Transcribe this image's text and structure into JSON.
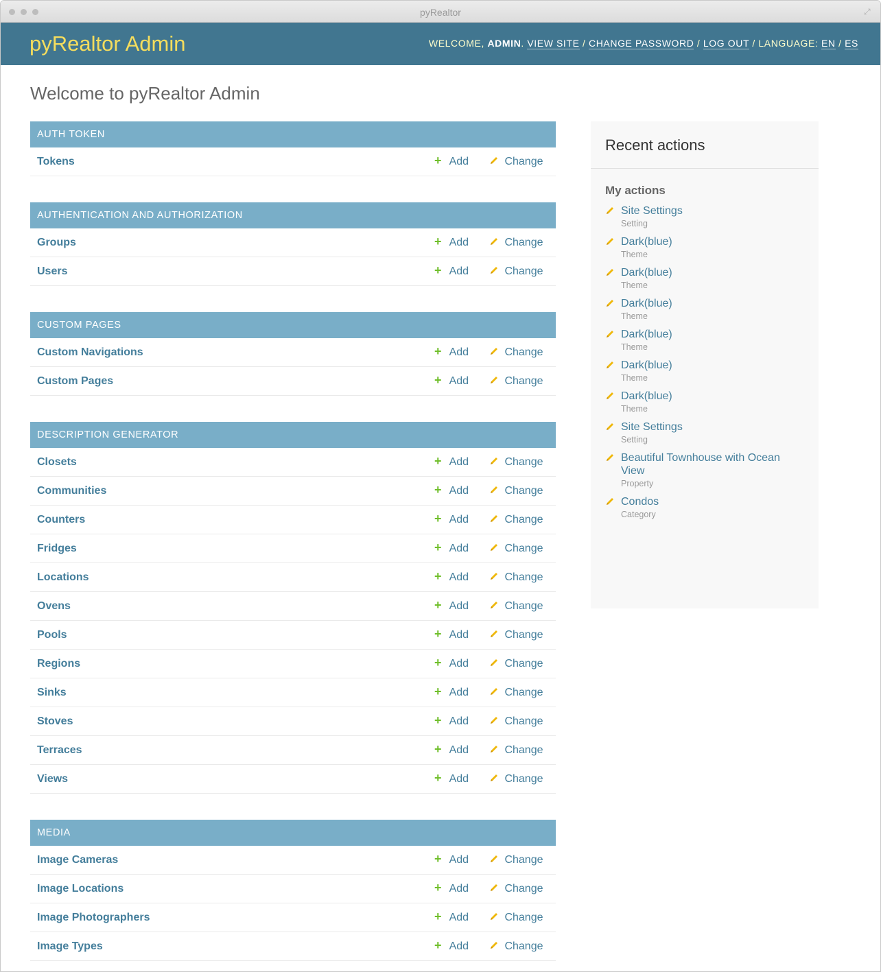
{
  "window": {
    "title": "pyRealtor"
  },
  "header": {
    "brand": "pyRealtor Admin",
    "welcome": "WELCOME,",
    "username": "ADMIN",
    "links": {
      "view_site": "VIEW SITE",
      "change_password": "CHANGE PASSWORD",
      "log_out": "LOG OUT",
      "language_label": "LANGUAGE:",
      "lang_en": "EN",
      "lang_es": "ES"
    }
  },
  "page": {
    "title": "Welcome to pyRealtor Admin"
  },
  "labels": {
    "add": "Add",
    "change": "Change"
  },
  "modules": [
    {
      "caption": "AUTH TOKEN",
      "models": [
        "Tokens"
      ]
    },
    {
      "caption": "AUTHENTICATION AND AUTHORIZATION",
      "models": [
        "Groups",
        "Users"
      ]
    },
    {
      "caption": "CUSTOM PAGES",
      "models": [
        "Custom Navigations",
        "Custom Pages"
      ]
    },
    {
      "caption": "DESCRIPTION GENERATOR",
      "models": [
        "Closets",
        "Communities",
        "Counters",
        "Fridges",
        "Locations",
        "Ovens",
        "Pools",
        "Regions",
        "Sinks",
        "Stoves",
        "Terraces",
        "Views"
      ]
    },
    {
      "caption": "MEDIA",
      "models": [
        "Image Cameras",
        "Image Locations",
        "Image Photographers",
        "Image Types"
      ]
    }
  ],
  "sidebar": {
    "title": "Recent actions",
    "subtitle": "My actions",
    "actions": [
      {
        "name": "Site Settings",
        "type": "Setting"
      },
      {
        "name": "Dark(blue)",
        "type": "Theme"
      },
      {
        "name": "Dark(blue)",
        "type": "Theme"
      },
      {
        "name": "Dark(blue)",
        "type": "Theme"
      },
      {
        "name": "Dark(blue)",
        "type": "Theme"
      },
      {
        "name": "Dark(blue)",
        "type": "Theme"
      },
      {
        "name": "Dark(blue)",
        "type": "Theme"
      },
      {
        "name": "Site Settings",
        "type": "Setting"
      },
      {
        "name": "Beautiful Townhouse with Ocean View",
        "type": "Property"
      },
      {
        "name": "Condos",
        "type": "Category"
      }
    ]
  },
  "icons": {
    "add": "plus-icon",
    "change": "pencil-icon"
  },
  "colors": {
    "header_bg": "#417690",
    "brand": "#f5dd5d",
    "caption_bg": "#79aec8",
    "link": "#447e9b",
    "add_green": "#70bf2b",
    "pencil_yellow": "#efb80b"
  }
}
